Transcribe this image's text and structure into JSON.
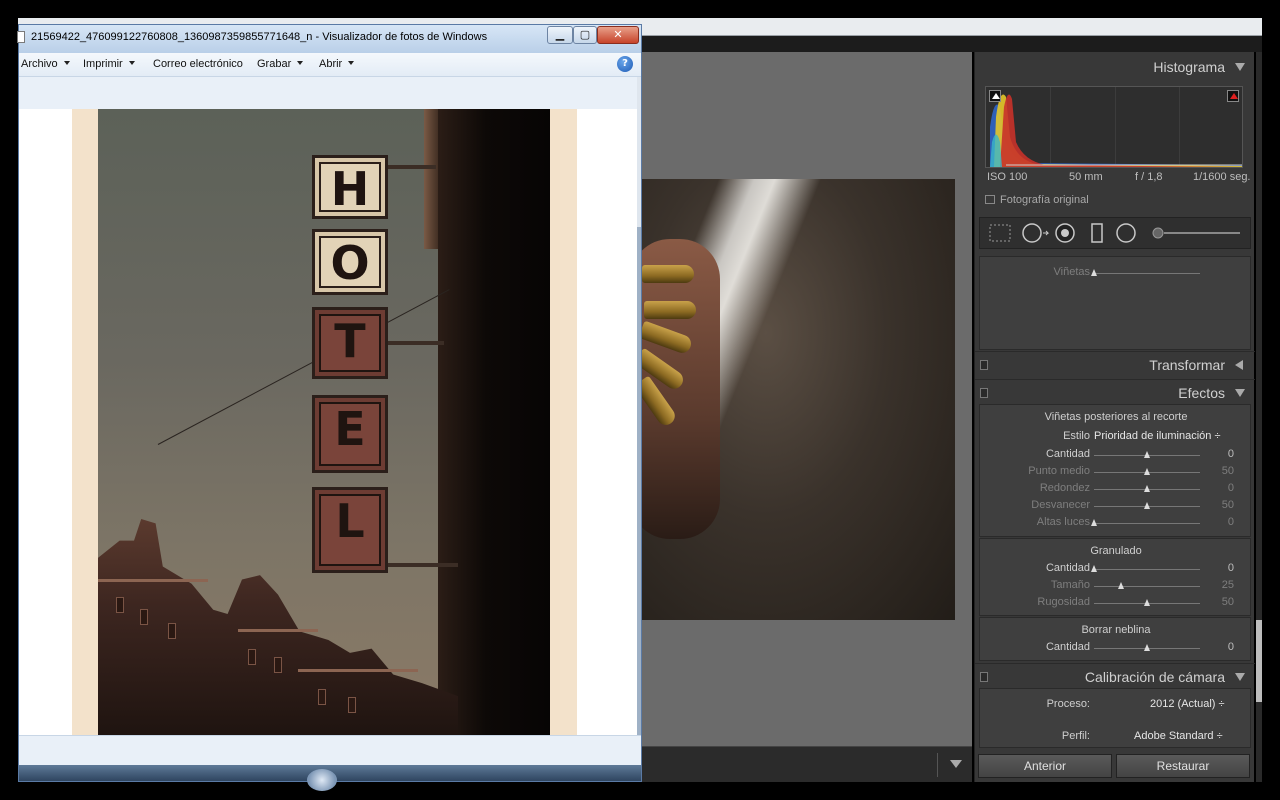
{
  "viewer": {
    "title": "21569422_476099122760808_1360987359855771648_n - Visualizador de fotos de Windows",
    "minimize_symbol": "▁",
    "maximize_symbol": "▢",
    "close_symbol": "✕",
    "menu": [
      {
        "label": "Archivo"
      },
      {
        "label": "Imprimir"
      },
      {
        "label": "Correo electrónico"
      },
      {
        "label": "Grabar"
      },
      {
        "label": "Abrir"
      }
    ],
    "help_symbol": "?",
    "photo_sign_letters": [
      "H",
      "O",
      "T",
      "E",
      "L"
    ]
  },
  "lightroom": {
    "histogram": {
      "title": "Histograma",
      "iso": "ISO 100",
      "focal": "50 mm",
      "aperture": "f / 1,8",
      "shutter": "1/1600 seg.",
      "original_photo_label": "Fotografía original"
    },
    "vignette_label": "Viñetas",
    "transform_title": "Transformar",
    "effects": {
      "title": "Efectos",
      "post_crop_title": "Viñetas posteriores al recorte",
      "style_label": "Estilo",
      "style_value": "Prioridad de iluminación ÷",
      "rows": [
        {
          "label": "Cantidad",
          "value": "0",
          "pos": 0.5
        },
        {
          "label": "Punto medio",
          "value": "50",
          "pos": 0.5
        },
        {
          "label": "Redondez",
          "value": "0",
          "pos": 0.5
        },
        {
          "label": "Desvanecer",
          "value": "50",
          "pos": 0.5
        },
        {
          "label": "Altas luces",
          "value": "0",
          "pos": 0.0
        }
      ],
      "grain_title": "Granulado",
      "grain_rows": [
        {
          "label": "Cantidad",
          "value": "0",
          "pos": 0.0
        },
        {
          "label": "Tamaño",
          "value": "25",
          "pos": 0.25
        },
        {
          "label": "Rugosidad",
          "value": "50",
          "pos": 0.5
        }
      ],
      "dehaze_title": "Borrar neblina",
      "dehaze_rows": [
        {
          "label": "Cantidad",
          "value": "0",
          "pos": 0.5
        }
      ]
    },
    "calibration": {
      "title": "Calibración de cámara",
      "process_label": "Proceso:",
      "process_value": "2012 (Actual) ÷",
      "profile_label": "Perfil:",
      "profile_value": "Adobe Standard ÷"
    },
    "buttons": {
      "previous": "Anterior",
      "reset": "Restaurar"
    }
  }
}
